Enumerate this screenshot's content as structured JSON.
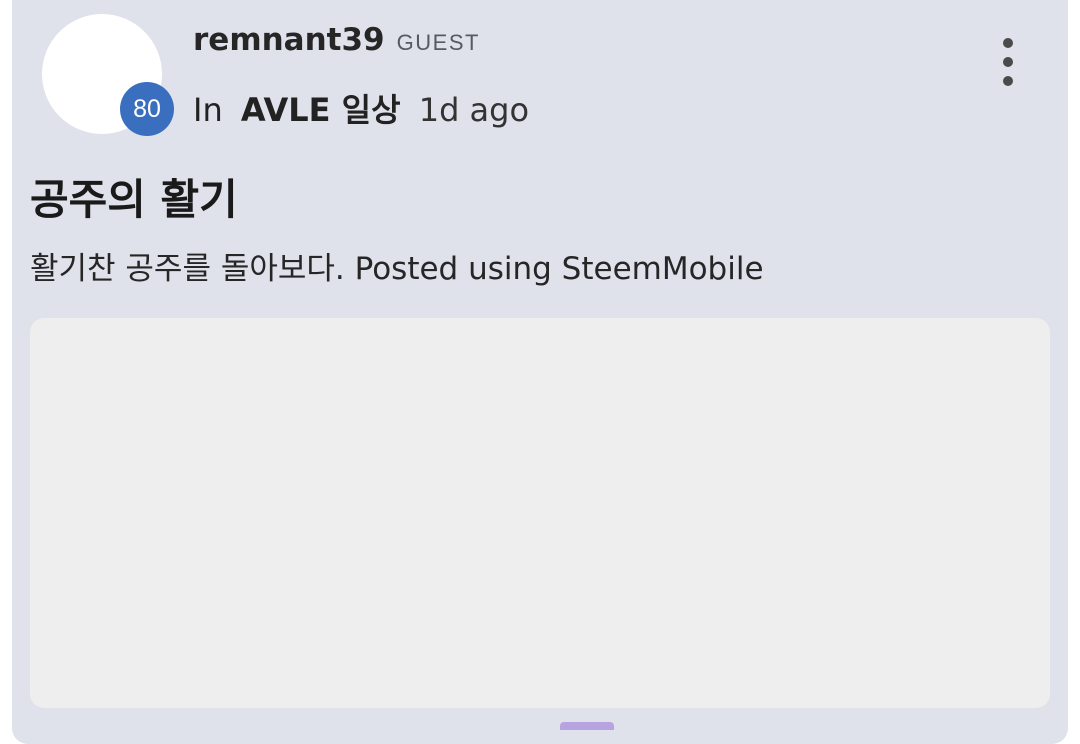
{
  "post": {
    "author": "remnant39",
    "author_badge": "GUEST",
    "reputation": "80",
    "in_label": "In",
    "community": "AVLE 일상",
    "time_ago": "1d ago",
    "title": "공주의 활기",
    "summary": "활기찬 공주를 돌아보다. Posted using SteemMobile"
  },
  "icons": {
    "more": "more-vertical-icon"
  },
  "colors": {
    "card_background": "#dfe1eb",
    "reputation_badge": "#3a6fc0",
    "image_placeholder": "#eeeeee",
    "indicator": "#b7a3e0"
  }
}
